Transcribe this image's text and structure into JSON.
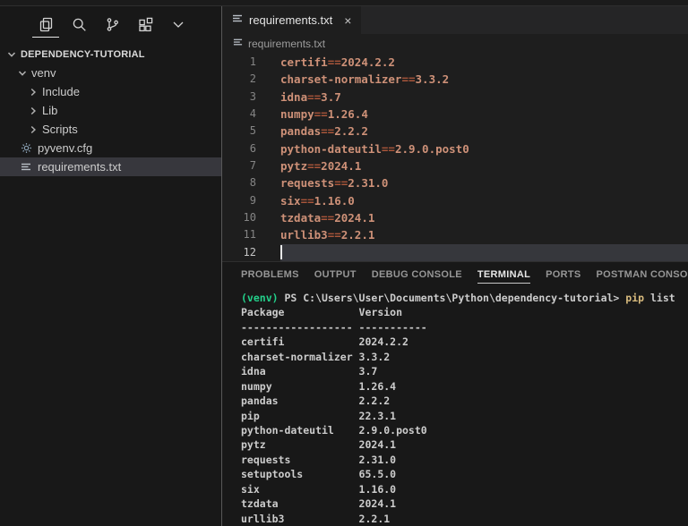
{
  "activity_bar": {
    "icons": [
      "files",
      "search",
      "source-control",
      "extensions",
      "more-views"
    ]
  },
  "sidebar": {
    "root": "DEPENDENCY-TUTORIAL",
    "items": [
      {
        "label": "venv"
      },
      {
        "label": "Include"
      },
      {
        "label": "Lib"
      },
      {
        "label": "Scripts"
      },
      {
        "label": "pyvenv.cfg"
      },
      {
        "label": "requirements.txt"
      }
    ]
  },
  "tab": {
    "label": "requirements.txt",
    "close": "×"
  },
  "breadcrumb": {
    "label": "requirements.txt"
  },
  "editor": {
    "lines": [
      {
        "num": "1",
        "name": "certifi",
        "op": "==",
        "ver": "2024.2.2"
      },
      {
        "num": "2",
        "name": "charset-normalizer",
        "op": "==",
        "ver": "3.3.2"
      },
      {
        "num": "3",
        "name": "idna",
        "op": "==",
        "ver": "3.7"
      },
      {
        "num": "4",
        "name": "numpy",
        "op": "==",
        "ver": "1.26.4"
      },
      {
        "num": "5",
        "name": "pandas",
        "op": "==",
        "ver": "2.2.2"
      },
      {
        "num": "6",
        "name": "python-dateutil",
        "op": "==",
        "ver": "2.9.0.post0"
      },
      {
        "num": "7",
        "name": "pytz",
        "op": "==",
        "ver": "2024.1"
      },
      {
        "num": "8",
        "name": "requests",
        "op": "==",
        "ver": "2.31.0"
      },
      {
        "num": "9",
        "name": "six",
        "op": "==",
        "ver": "1.16.0"
      },
      {
        "num": "10",
        "name": "tzdata",
        "op": "==",
        "ver": "2024.1"
      },
      {
        "num": "11",
        "name": "urllib3",
        "op": "==",
        "ver": "2.2.1"
      },
      {
        "num": "12",
        "name": "",
        "op": "",
        "ver": ""
      }
    ]
  },
  "panel": {
    "tabs": [
      {
        "label": "PROBLEMS"
      },
      {
        "label": "OUTPUT"
      },
      {
        "label": "DEBUG CONSOLE"
      },
      {
        "label": "TERMINAL",
        "active": true
      },
      {
        "label": "PORTS"
      },
      {
        "label": "POSTMAN CONSOLE"
      }
    ]
  },
  "terminal": {
    "prompt": {
      "venv": "(venv)",
      "shell": " PS C:\\Users\\User\\Documents\\Python\\dependency-tutorial>",
      "cmd": " pip",
      "arg": " list"
    },
    "lines": [
      "Package            Version",
      "------------------ -----------",
      "certifi            2024.2.2",
      "charset-normalizer 3.3.2",
      "idna               3.7",
      "numpy              1.26.4",
      "pandas             2.2.2",
      "pip                22.3.1",
      "python-dateutil    2.9.0.post0",
      "pytz               2024.1",
      "requests           2.31.0",
      "setuptools         65.5.0",
      "six                1.16.0",
      "tzdata             2024.1",
      "urllib3            2.2.1"
    ]
  },
  "colors": {
    "code_text": "#ce9178",
    "code_operator": "#a8553a",
    "terminal_green": "#23d18b",
    "terminal_yellow": "#d7ba7d",
    "terminal_text": "#cccccc",
    "selection_bg": "#37373d"
  }
}
